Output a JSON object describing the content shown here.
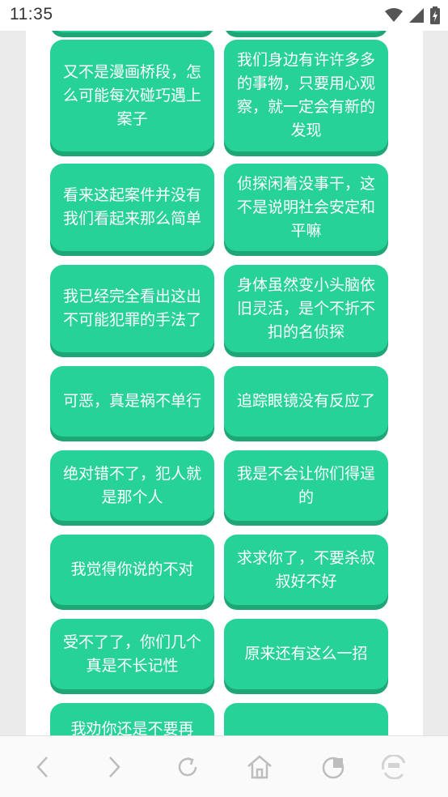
{
  "status_bar": {
    "time": "11:35",
    "icons": [
      "wifi-icon",
      "signal-icon",
      "battery-charging-icon"
    ]
  },
  "phrases": [
    {
      "label": ""
    },
    {
      "label": ""
    },
    {
      "label": "又不是漫画桥段，怎么可能每次碰巧遇上案子"
    },
    {
      "label": "我们身边有许许多多的事物，只要用心观察，就一定会有新的发现"
    },
    {
      "label": "看来这起案件并没有我们看起来那么简单"
    },
    {
      "label": "侦探闲着没事干，这不是说明社会安定和平嘛"
    },
    {
      "label": "我已经完全看出这出不可能犯罪的手法了"
    },
    {
      "label": "身体虽然变小头脑依旧灵活，是个不折不扣的名侦探"
    },
    {
      "label": "可恶，真是祸不单行"
    },
    {
      "label": "追踪眼镜没有反应了"
    },
    {
      "label": "绝对错不了，犯人就是那个人"
    },
    {
      "label": "我是不会让你们得逞的"
    },
    {
      "label": "我觉得你说的不对"
    },
    {
      "label": "求求你了，不要杀叔叔好不好"
    },
    {
      "label": "受不了了，你们几个真是不长记性"
    },
    {
      "label": "原来还有这么一招"
    },
    {
      "label": "我劝你还是不要再"
    },
    {
      "label": ""
    }
  ],
  "bottom_nav": {
    "items": [
      "back-icon",
      "forward-icon",
      "refresh-icon",
      "home-icon",
      "tabs-icon",
      "menu-icon"
    ]
  }
}
